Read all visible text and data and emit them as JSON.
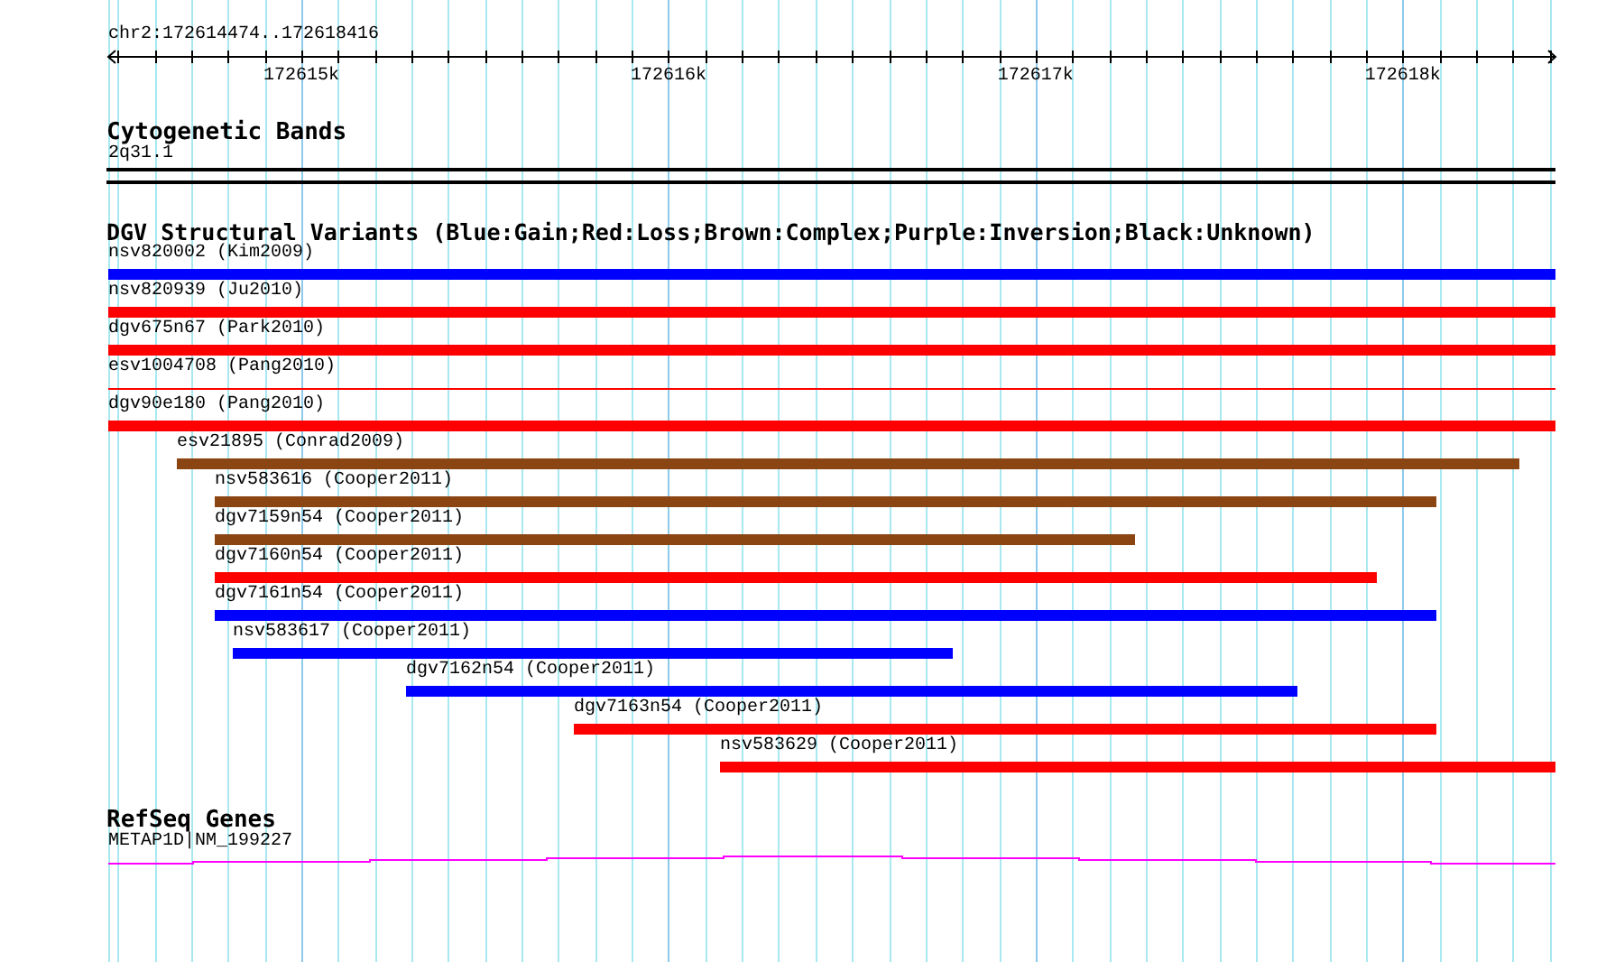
{
  "ruler": {
    "title": "chr2:172614474..172618416",
    "ticks": [
      "172615k",
      "172616k",
      "172617k",
      "172618k"
    ]
  },
  "cytogenetic_bands": {
    "title": "Cytogenetic Bands",
    "band": "2q31.1"
  },
  "dgv_track": {
    "title": "DGV Structural Variants (Blue:Gain;Red:Loss;Brown:Complex;Purple:Inversion;Black:Unknown)",
    "features": [
      {
        "label": "nsv820002 (Kim2009)",
        "kind": "bar",
        "color": "#0000ff"
      },
      {
        "label": "nsv820939 (Ju2010)",
        "kind": "bar",
        "color": "#ff0000"
      },
      {
        "label": "dgv675n67 (Park2010)",
        "kind": "bar",
        "color": "#ff0000"
      },
      {
        "label": "esv1004708 (Pang2010)",
        "kind": "line",
        "color": "#ff0000"
      },
      {
        "label": "dgv90e180 (Pang2010)",
        "kind": "bar",
        "color": "#ff0000"
      },
      {
        "label": "esv21895 (Conrad2009)",
        "kind": "bar",
        "color": "#8b4513"
      },
      {
        "label": "nsv583616 (Cooper2011)",
        "kind": "bar",
        "color": "#8b4513"
      },
      {
        "label": "dgv7159n54 (Cooper2011)",
        "kind": "bar",
        "color": "#8b4513"
      },
      {
        "label": "dgv7160n54 (Cooper2011)",
        "kind": "bar",
        "color": "#ff0000"
      },
      {
        "label": "dgv7161n54 (Cooper2011)",
        "kind": "bar",
        "color": "#0000ff"
      },
      {
        "label": "nsv583617 (Cooper2011)",
        "kind": "bar",
        "color": "#0000ff"
      },
      {
        "label": "dgv7162n54 (Cooper2011)",
        "kind": "bar",
        "color": "#0000ff"
      },
      {
        "label": "dgv7163n54 (Cooper2011)",
        "kind": "bar",
        "color": "#ff0000"
      },
      {
        "label": "nsv583629 (Cooper2011)",
        "kind": "bar",
        "color": "#ff0000"
      }
    ]
  },
  "refseq_genes": {
    "title": "RefSeq Genes",
    "gene": "METAP1D|NM_199227"
  }
}
